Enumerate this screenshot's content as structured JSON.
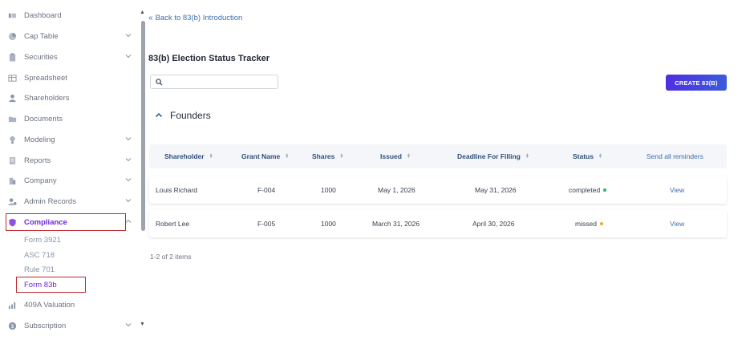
{
  "sidebar": {
    "items": [
      {
        "label": "Dashboard",
        "icon": "dashboard-icon",
        "chevron": false
      },
      {
        "label": "Cap Table",
        "icon": "pie-chart-icon",
        "chevron": true
      },
      {
        "label": "Securities",
        "icon": "clipboard-icon",
        "chevron": true
      },
      {
        "label": "Spreadsheet",
        "icon": "spreadsheet-icon",
        "chevron": false
      },
      {
        "label": "Shareholders",
        "icon": "user-icon",
        "chevron": false
      },
      {
        "label": "Documents",
        "icon": "folder-icon",
        "chevron": false
      },
      {
        "label": "Modeling",
        "icon": "bulb-icon",
        "chevron": true
      },
      {
        "label": "Reports",
        "icon": "report-icon",
        "chevron": true
      },
      {
        "label": "Company",
        "icon": "building-icon",
        "chevron": true
      },
      {
        "label": "Admin Records",
        "icon": "admin-icon",
        "chevron": true
      },
      {
        "label": "Compliance",
        "icon": "shield-icon",
        "chevron": true,
        "expanded": true,
        "active": true
      }
    ],
    "compliance_subitems": [
      "Form 3921",
      "ASC 718",
      "Rule 701",
      "Form 83b"
    ],
    "active_subitem": "Form 83b",
    "bottom_items": [
      {
        "label": "409A Valuation",
        "icon": "valuation-icon",
        "chevron": false
      },
      {
        "label": "Subscription",
        "icon": "subscription-icon",
        "chevron": true
      }
    ]
  },
  "main": {
    "back_label": "Back to 83(b) Introduction",
    "page_title": "83(b) Election Status Tracker",
    "search": {
      "value": "",
      "placeholder": ""
    },
    "create_button": "CREATE 83(B)",
    "section_title": "Founders",
    "table": {
      "columns": [
        "Shareholder",
        "Grant Name",
        "Shares",
        "Issued",
        "Deadline For Filling",
        "Status"
      ],
      "action_header": "Send all reminders",
      "rows": [
        {
          "shareholder": "Louis Richard",
          "grant_name": "F-004",
          "shares": "1000",
          "issued": "May 1, 2026",
          "deadline": "May 31, 2026",
          "status": "completed",
          "status_color": "#2bb673",
          "action": "View"
        },
        {
          "shareholder": "Robert Lee",
          "grant_name": "F-005",
          "shares": "1000",
          "issued": "March 31, 2026",
          "deadline": "April 30, 2026",
          "status": "missed",
          "status_color": "#f5a623",
          "action": "View"
        }
      ]
    },
    "pagination_text": "1-2 of 2 items"
  },
  "colors": {
    "accent": "#6d28d9",
    "link": "#3f6ea8",
    "highlight_box": "#c0282f",
    "button_gradient_start": "#4f2fe0",
    "button_gradient_end": "#3b5bdb"
  }
}
